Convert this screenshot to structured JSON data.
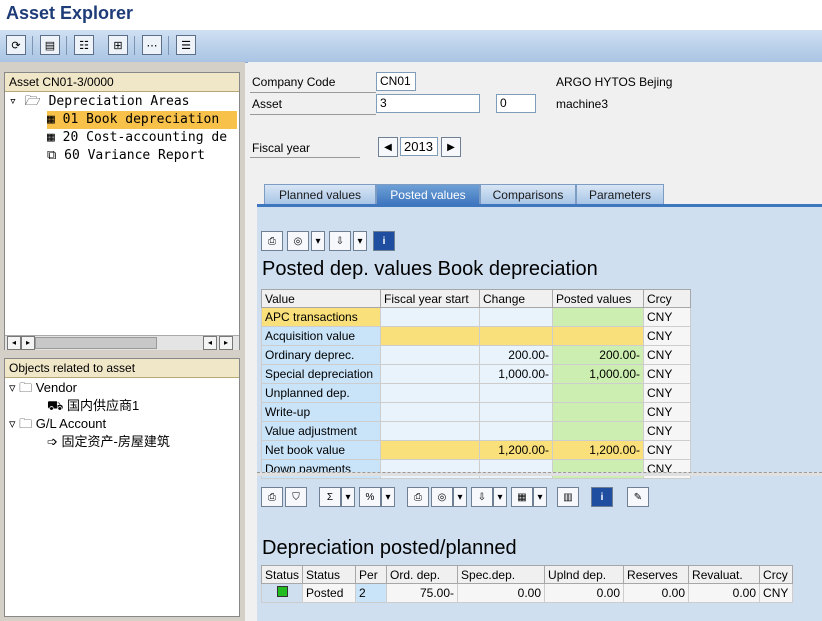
{
  "app": {
    "title": "Asset Explorer"
  },
  "toolbar": {
    "icons": [
      "refresh-icon",
      "document-icon",
      "hierarchy-icon",
      "expand-icon",
      "collapse-icon",
      "list-icon"
    ]
  },
  "tree": {
    "header": "Asset CN01-3/0000",
    "root": "Depreciation Areas",
    "items": [
      {
        "label": "01 Book depreciation",
        "selected": true
      },
      {
        "label": "20 Cost-accounting de"
      },
      {
        "label": "60 Variance Report"
      }
    ]
  },
  "objects": {
    "header": "Objects related to asset",
    "groups": [
      {
        "label": "Vendor",
        "child": "国内供应商1"
      },
      {
        "label": "G/L Account",
        "child": "固定资产-房屋建筑"
      }
    ]
  },
  "form": {
    "company_code_label": "Company Code",
    "company_code": "CN01",
    "company_name": "ARGO HYTOS Bejing",
    "asset_label": "Asset",
    "asset_no": "3",
    "asset_sub": "0",
    "asset_desc": "machine3",
    "fiscal_year_label": "Fiscal year",
    "fiscal_year": "2013"
  },
  "tabs": [
    "Planned values",
    "Posted values",
    "Comparisons",
    "Parameters"
  ],
  "posted": {
    "title": "Posted dep. values Book depreciation",
    "columns": [
      "Value",
      "Fiscal year start",
      "Change",
      "Posted values",
      "Crcy"
    ],
    "rows": [
      {
        "label": "APC transactions",
        "start": "",
        "change": "",
        "posted": "",
        "crcy": "CNY",
        "style": "sel"
      },
      {
        "label": "Acquisition value",
        "start": "",
        "change": "",
        "posted": "",
        "crcy": "CNY",
        "style": "yellow"
      },
      {
        "label": "Ordinary deprec.",
        "start": "",
        "change": "200.00-",
        "posted": "200.00-",
        "crcy": "CNY",
        "style": "normal"
      },
      {
        "label": "Special depreciation",
        "start": "",
        "change": "1,000.00-",
        "posted": "1,000.00-",
        "crcy": "CNY",
        "style": "normal"
      },
      {
        "label": "Unplanned dep.",
        "start": "",
        "change": "",
        "posted": "",
        "crcy": "CNY",
        "style": "normal"
      },
      {
        "label": "Write-up",
        "start": "",
        "change": "",
        "posted": "",
        "crcy": "CNY",
        "style": "normal"
      },
      {
        "label": "Value adjustment",
        "start": "",
        "change": "",
        "posted": "",
        "crcy": "CNY",
        "style": "normal"
      },
      {
        "label": "Net book value",
        "start": "",
        "change": "1,200.00-",
        "posted": "1,200.00-",
        "crcy": "CNY",
        "style": "yellow"
      },
      {
        "label": "Down payments",
        "start": "",
        "change": "",
        "posted": "",
        "crcy": "CNY",
        "style": "normal"
      }
    ]
  },
  "planned": {
    "title": "Depreciation posted/planned",
    "columns": [
      "Status",
      "Status",
      "Per",
      "Ord. dep.",
      "Spec.dep.",
      "Uplnd dep.",
      "Reserves",
      "Revaluat.",
      "Crcy"
    ],
    "rows": [
      {
        "status_color": "#22bb22",
        "status": "Posted",
        "per": "2",
        "ord": "75.00-",
        "spec": "0.00",
        "uplnd": "0.00",
        "reserves": "0.00",
        "reval": "0.00",
        "crcy": "CNY"
      }
    ]
  }
}
